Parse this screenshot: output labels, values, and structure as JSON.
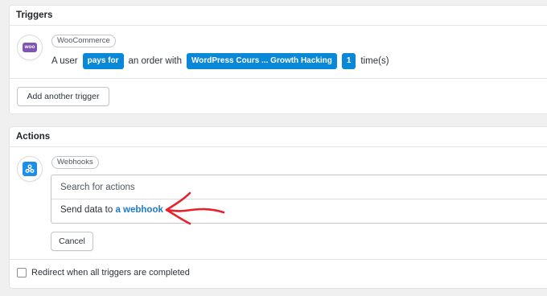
{
  "triggers": {
    "title": "Triggers",
    "integration": {
      "name": "WooCommerce",
      "icon": "woocommerce-logo-icon",
      "logo_text": "woo"
    },
    "sentence": {
      "prefix": "A user",
      "verb": "pays for",
      "middle": "an order with",
      "product": "WordPress Cours ... Growth Hacking",
      "count": "1",
      "suffix": "time(s)"
    },
    "add_button_label": "Add another trigger"
  },
  "actions": {
    "title": "Actions",
    "integration": {
      "name": "Webhooks",
      "icon": "webhooks-logo-icon"
    },
    "search_placeholder": "Search for actions",
    "result": {
      "prefix": "Send data to",
      "link": "a webhook"
    },
    "cancel_label": "Cancel",
    "redirect_label": "Redirect when all triggers are completed",
    "redirect_checked": false
  },
  "colors": {
    "accent": "#0a88d8",
    "link": "#1d7bd1",
    "woo_purple": "#7f54b3",
    "webhook_blue": "#1e8fe8",
    "annotation_red": "#e8202a"
  }
}
